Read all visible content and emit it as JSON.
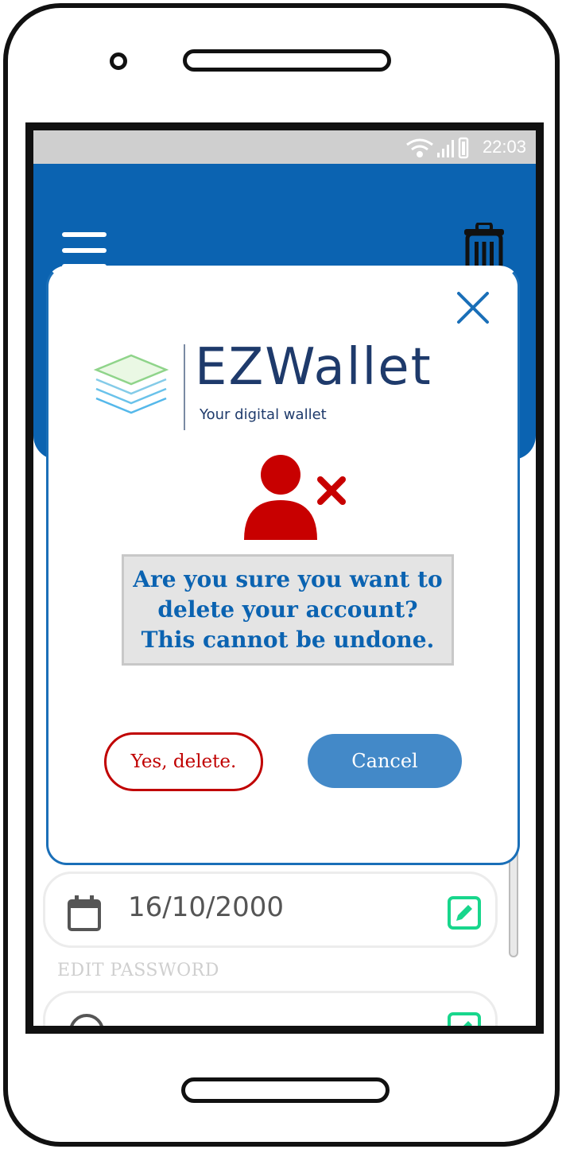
{
  "status_bar": {
    "time": "22:03"
  },
  "header": {
    "menu_icon": "hamburger-menu-icon",
    "delete_icon": "trash-icon"
  },
  "dialog": {
    "close_icon": "close-icon",
    "logo": {
      "name": "EZWallet",
      "tagline": "Your digital wallet"
    },
    "warning_icon": "delete-user-icon",
    "message": "Are you sure you want to\ndelete your account?\nThis cannot be undone.",
    "confirm_label": "Yes, delete.",
    "cancel_label": "Cancel"
  },
  "background_form": {
    "birthdate_value": "16/10/2000",
    "edit_password_label": "EDIT PASSWORD"
  },
  "colors": {
    "primary": "#0b63b1",
    "danger": "#c00000",
    "cancel_button": "#4389c8",
    "edit_icon": "#18d68c"
  }
}
